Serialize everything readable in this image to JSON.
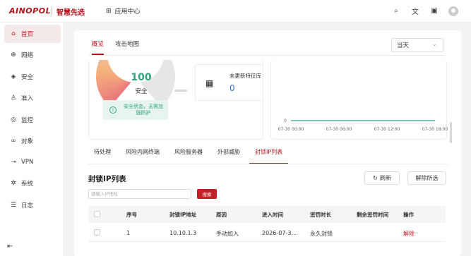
{
  "brand": {
    "logo_text": "AINOPOL",
    "slogan": "智慧先选"
  },
  "topbar": {
    "app_center_label": "应用中心",
    "icons": [
      "grid-icon",
      "search-icon",
      "translate-icon",
      "save-icon",
      "avatar-icon"
    ]
  },
  "sidebar": {
    "items": [
      {
        "label": "首页",
        "icon": "home-icon",
        "active": true
      },
      {
        "label": "网络",
        "icon": "globe-icon",
        "active": false
      },
      {
        "label": "安全",
        "icon": "shield-icon",
        "active": false
      },
      {
        "label": "准入",
        "icon": "users-icon",
        "active": false
      },
      {
        "label": "监控",
        "icon": "monitor-icon",
        "active": false
      },
      {
        "label": "对象",
        "icon": "link-icon",
        "active": false
      },
      {
        "label": "VPN",
        "icon": "key-icon",
        "active": false
      },
      {
        "label": "系统",
        "icon": "gear-icon",
        "active": false
      },
      {
        "label": "日志",
        "icon": "list-icon",
        "active": false
      }
    ],
    "collapse_icon": "collapse-icon"
  },
  "main": {
    "tabs": [
      {
        "label": "概览",
        "active": true
      },
      {
        "label": "攻击地图",
        "active": false
      }
    ],
    "time_select": {
      "value": "当天"
    },
    "gauge": {
      "score": "100",
      "level": "安全",
      "scale_min": "20"
    },
    "safe_notice": "安全状态，无需加强防护",
    "signature": {
      "label": "未更新特征库",
      "value": "0"
    },
    "chart_data": {
      "type": "line",
      "x": [
        "07-30 00:00",
        "07-30 06:00",
        "07-30 12:00",
        "07-30 18:00"
      ],
      "series": [
        {
          "values": [
            0,
            0,
            0,
            0
          ]
        }
      ],
      "ytick_label": "0",
      "line_color": "#4ab6a6"
    },
    "sub_tabs": [
      {
        "label": "待处理",
        "active": false
      },
      {
        "label": "风险内网终端",
        "active": false
      },
      {
        "label": "风险服务器",
        "active": false
      },
      {
        "label": "外部威胁",
        "active": false
      },
      {
        "label": "封锁IP列表",
        "active": true
      }
    ],
    "blocked_list": {
      "title": "封锁IP列表",
      "refresh_label": "刷新",
      "release_label": "解除所选",
      "search_placeholder": "请输入IP地址",
      "search_button": "搜索",
      "columns": [
        "序号",
        "封锁IP地址",
        "原因",
        "进入时间",
        "惩罚时长",
        "剩余惩罚时间",
        "操作"
      ],
      "rows": [
        {
          "index": "1",
          "ip": "10.10.1.3",
          "reason": "手动加入",
          "time": "2026-07-3...",
          "duration": "永久封锁",
          "remaining": "",
          "action": "解除"
        }
      ]
    }
  },
  "colors": {
    "accent": "#b4141b",
    "safe_green": "#2fa37e",
    "value_blue": "#2f6fd8",
    "chart_line": "#4ab6a6"
  }
}
